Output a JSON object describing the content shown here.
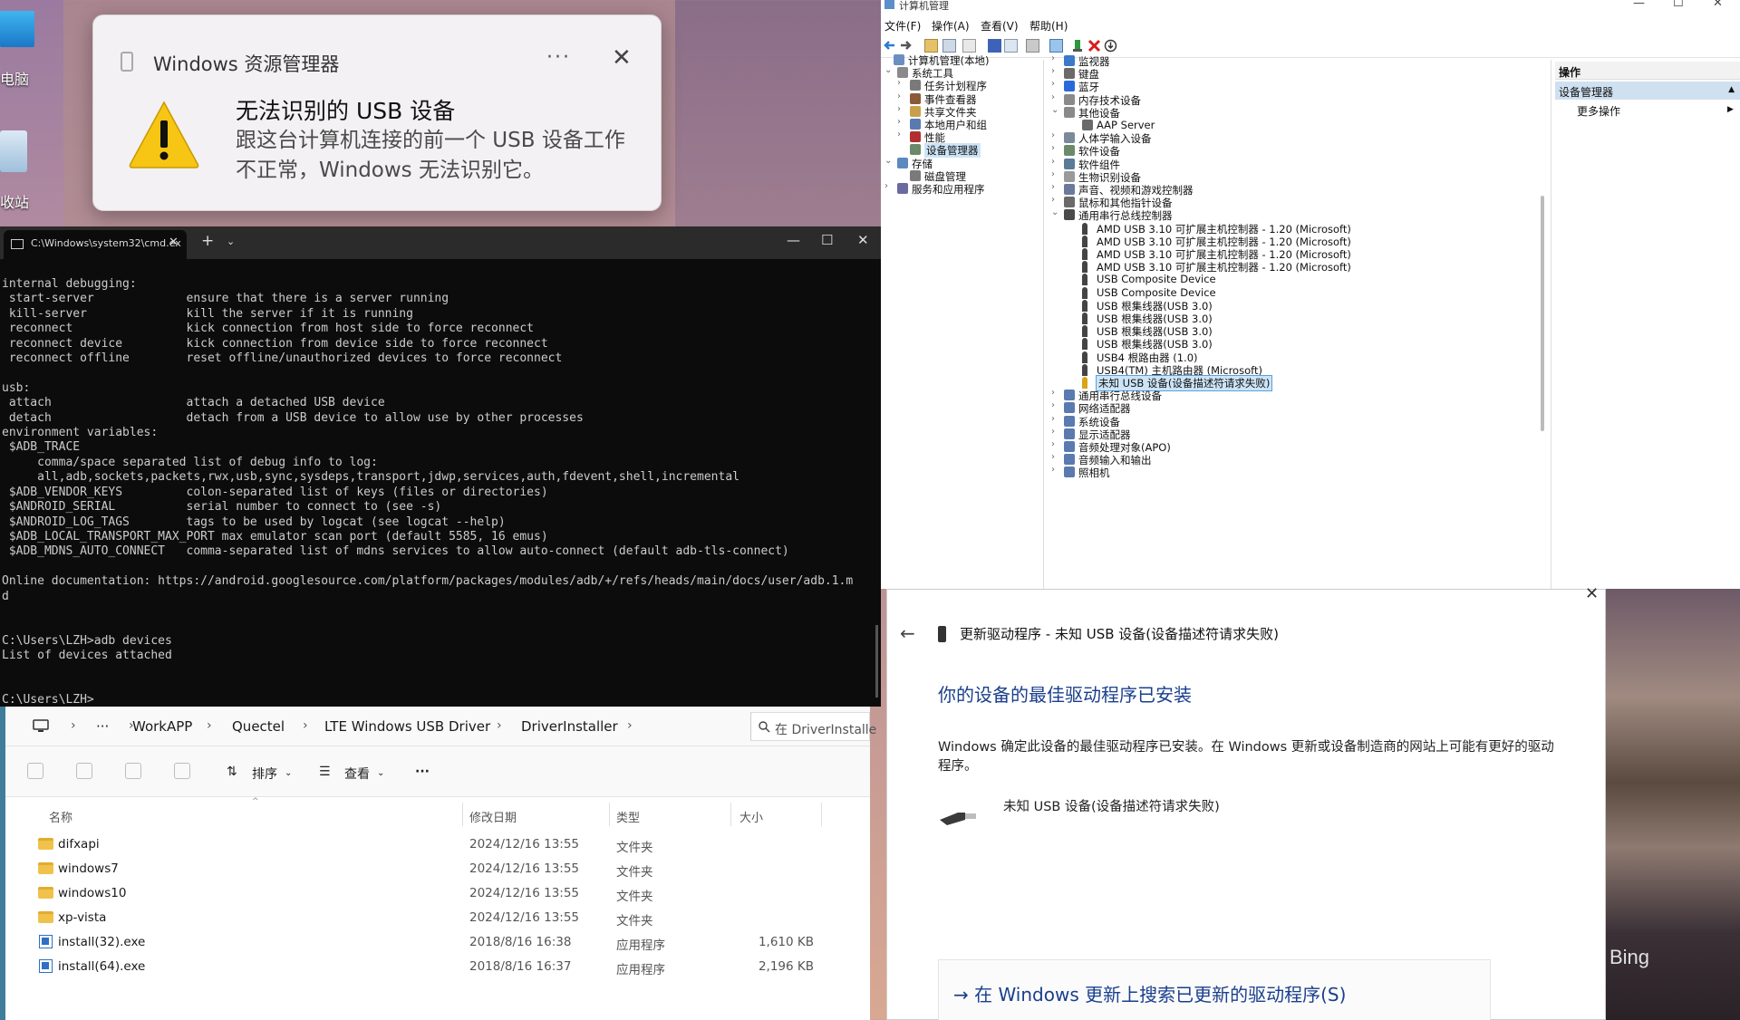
{
  "desktop": {
    "icons": [
      {
        "label": "电脑",
        "icon": "computer-icon"
      },
      {
        "label": "收站",
        "icon": "recycle-bin-icon"
      }
    ],
    "wallpaper_mark": "Bing"
  },
  "notification": {
    "app_name": "Windows 资源管理器",
    "more": "···",
    "close": "✕",
    "title": "无法识别的 USB 设备",
    "body": "跟这台计算机连接的前一个 USB 设备工作不正常，Windows 无法识别它。",
    "icon": "warning-icon"
  },
  "cmd": {
    "tab_title": "C:\\Windows\\system32\\cmd.ex",
    "tab_close": "✕",
    "new_tab": "+",
    "dropdown": "⌄",
    "window_buttons": [
      "—",
      "☐",
      "✕"
    ],
    "output": "internal debugging:\n start-server             ensure that there is a server running\n kill-server              kill the server if it is running\n reconnect                kick connection from host side to force reconnect\n reconnect device         kick connection from device side to force reconnect\n reconnect offline        reset offline/unauthorized devices to force reconnect\n\nusb:\n attach                   attach a detached USB device\n detach                   detach from a USB device to allow use by other processes\nenvironment variables:\n $ADB_TRACE\n     comma/space separated list of debug info to log:\n     all,adb,sockets,packets,rwx,usb,sync,sysdeps,transport,jdwp,services,auth,fdevent,shell,incremental\n $ADB_VENDOR_KEYS         colon-separated list of keys (files or directories)\n $ANDROID_SERIAL          serial number to connect to (see -s)\n $ANDROID_LOG_TAGS        tags to be used by logcat (see logcat --help)\n $ADB_LOCAL_TRANSPORT_MAX_PORT max emulator scan port (default 5585, 16 emus)\n $ADB_MDNS_AUTO_CONNECT   comma-separated list of mdns services to allow auto-connect (default adb-tls-connect)\n\nOnline documentation: https://android.googlesource.com/platform/packages/modules/adb/+/refs/heads/main/docs/user/adb.1.m\nd\n\n\nC:\\Users\\LZH>adb devices\nList of devices attached\n\n\nC:\\Users\\LZH>"
  },
  "explorer": {
    "breadcrumb": [
      "WorkAPP",
      "Quectel",
      "LTE Windows USB Driver",
      "DriverInstaller"
    ],
    "ellipsis": "···",
    "search_placeholder": "在 DriverInstalle",
    "sort_label": "排序",
    "view_label": "查看",
    "more_label": "···",
    "columns": {
      "name": "名称",
      "date": "修改日期",
      "type": "类型",
      "size": "大小"
    },
    "rows": [
      {
        "name": "difxapi",
        "date": "2024/12/16 13:55",
        "type": "文件夹",
        "size": "",
        "kind": "folder"
      },
      {
        "name": "windows7",
        "date": "2024/12/16 13:55",
        "type": "文件夹",
        "size": "",
        "kind": "folder"
      },
      {
        "name": "windows10",
        "date": "2024/12/16 13:55",
        "type": "文件夹",
        "size": "",
        "kind": "folder"
      },
      {
        "name": "xp-vista",
        "date": "2024/12/16 13:55",
        "type": "文件夹",
        "size": "",
        "kind": "folder"
      },
      {
        "name": "install(32).exe",
        "date": "2018/8/16 16:38",
        "type": "应用程序",
        "size": "1,610 KB",
        "kind": "exe"
      },
      {
        "name": "install(64).exe",
        "date": "2018/8/16 16:37",
        "type": "应用程序",
        "size": "2,196 KB",
        "kind": "exe"
      }
    ]
  },
  "compmgmt": {
    "title": "计算机管理",
    "window_buttons": [
      "—",
      "☐",
      "✕"
    ],
    "menu": [
      "文件(F)",
      "操作(A)",
      "查看(V)",
      "帮助(H)"
    ],
    "left_tree": [
      {
        "label": "计算机管理(本地)",
        "arrow": ""
      },
      {
        "label": "系统工具",
        "arrow": "⌄"
      },
      {
        "label": "任务计划程序",
        "arrow": "›"
      },
      {
        "label": "事件查看器",
        "arrow": "›"
      },
      {
        "label": "共享文件夹",
        "arrow": "›"
      },
      {
        "label": "本地用户和组",
        "arrow": "›"
      },
      {
        "label": "性能",
        "arrow": "›"
      },
      {
        "label": "设备管理器",
        "arrow": ""
      },
      {
        "label": "存储",
        "arrow": "⌄"
      },
      {
        "label": "磁盘管理",
        "arrow": ""
      },
      {
        "label": "服务和应用程序",
        "arrow": "›"
      }
    ],
    "device_tree": [
      {
        "label": "监视器",
        "arrow": "›"
      },
      {
        "label": "键盘",
        "arrow": "›"
      },
      {
        "label": "蓝牙",
        "arrow": "›"
      },
      {
        "label": "内存技术设备",
        "arrow": "›"
      },
      {
        "label": "其他设备",
        "arrow": "⌄"
      },
      {
        "label": "AAP Server",
        "arrow": ""
      },
      {
        "label": "人体学输入设备",
        "arrow": "›"
      },
      {
        "label": "软件设备",
        "arrow": "›"
      },
      {
        "label": "软件组件",
        "arrow": "›"
      },
      {
        "label": "生物识别设备",
        "arrow": "›"
      },
      {
        "label": "声音、视频和游戏控制器",
        "arrow": "›"
      },
      {
        "label": "鼠标和其他指针设备",
        "arrow": "›"
      },
      {
        "label": "通用串行总线控制器",
        "arrow": "⌄"
      },
      {
        "label": "AMD USB 3.10 可扩展主机控制器 - 1.20 (Microsoft)",
        "arrow": ""
      },
      {
        "label": "AMD USB 3.10 可扩展主机控制器 - 1.20 (Microsoft)",
        "arrow": ""
      },
      {
        "label": "AMD USB 3.10 可扩展主机控制器 - 1.20 (Microsoft)",
        "arrow": ""
      },
      {
        "label": "AMD USB 3.10 可扩展主机控制器 - 1.20 (Microsoft)",
        "arrow": ""
      },
      {
        "label": "USB Composite Device",
        "arrow": ""
      },
      {
        "label": "USB Composite Device",
        "arrow": ""
      },
      {
        "label": "USB 根集线器(USB 3.0)",
        "arrow": ""
      },
      {
        "label": "USB 根集线器(USB 3.0)",
        "arrow": ""
      },
      {
        "label": "USB 根集线器(USB 3.0)",
        "arrow": ""
      },
      {
        "label": "USB 根集线器(USB 3.0)",
        "arrow": ""
      },
      {
        "label": "USB4 根路由器 (1.0)",
        "arrow": ""
      },
      {
        "label": "USB4(TM) 主机路由器 (Microsoft)",
        "arrow": ""
      },
      {
        "label": "未知 USB 设备(设备描述符请求失败)",
        "arrow": ""
      },
      {
        "label": "通用串行总线设备",
        "arrow": "›"
      },
      {
        "label": "网络适配器",
        "arrow": "›"
      },
      {
        "label": "系统设备",
        "arrow": "›"
      },
      {
        "label": "显示适配器",
        "arrow": "›"
      },
      {
        "label": "音频处理对象(APO)",
        "arrow": "›"
      },
      {
        "label": "音频输入和输出",
        "arrow": "›"
      },
      {
        "label": "照相机",
        "arrow": "›"
      }
    ],
    "actions": {
      "header": "操作",
      "selected": "设备管理器",
      "selected_arrow": "▲",
      "more": "更多操作",
      "more_arrow": "▶"
    }
  },
  "driver_dialog": {
    "close": "✕",
    "back": "←",
    "header": "更新驱动程序 - 未知 USB 设备(设备描述符请求失败)",
    "title": "你的设备的最佳驱动程序已安装",
    "description": "Windows 确定此设备的最佳驱动程序已安装。在 Windows 更新或设备制造商的网站上可能有更好的驱动程序。",
    "device_name": "未知 USB 设备(设备描述符请求失败)",
    "search_link": "→ 在 Windows 更新上搜索已更新的驱动程序(S)"
  }
}
